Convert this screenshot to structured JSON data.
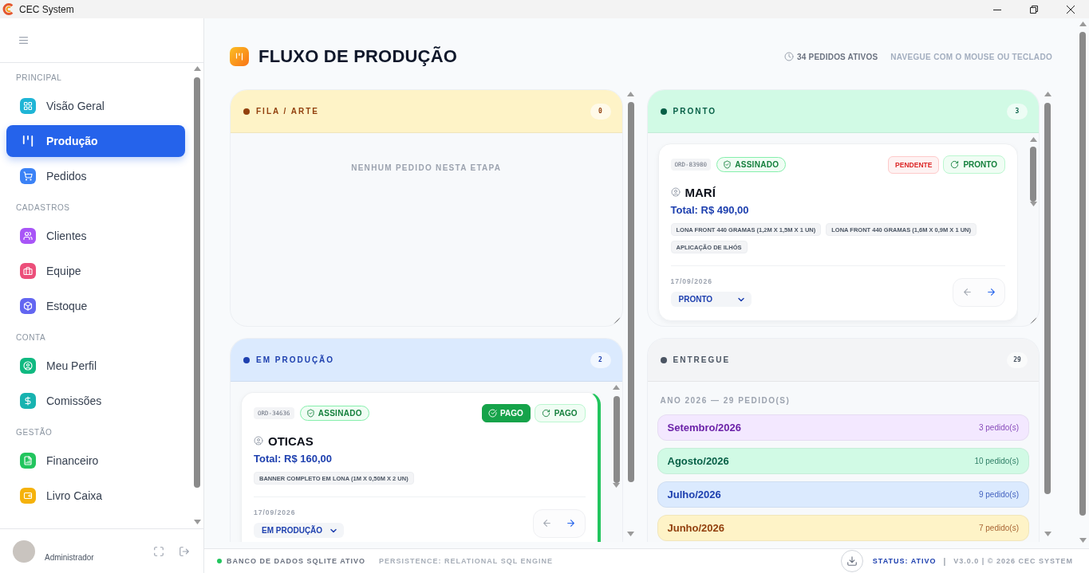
{
  "window": {
    "title": "CEC System"
  },
  "sidebar": {
    "sections": [
      {
        "label": "PRINCIPAL",
        "items": [
          {
            "label": "Visão Geral",
            "selected": false
          },
          {
            "label": "Produção",
            "selected": true
          },
          {
            "label": "Pedidos",
            "selected": false
          }
        ]
      },
      {
        "label": "CADASTROS",
        "items": [
          {
            "label": "Clientes",
            "selected": false
          },
          {
            "label": "Equipe",
            "selected": false
          },
          {
            "label": "Estoque",
            "selected": false
          }
        ]
      },
      {
        "label": "CONTA",
        "items": [
          {
            "label": "Meu Perfil",
            "selected": false
          },
          {
            "label": "Comissões",
            "selected": false
          }
        ]
      },
      {
        "label": "GESTÃO",
        "items": [
          {
            "label": "Financeiro",
            "selected": false
          },
          {
            "label": "Livro Caixa",
            "selected": false
          }
        ]
      }
    ],
    "user": {
      "role": "Administrador"
    }
  },
  "page": {
    "title": "FLUXO DE PRODUÇÃO",
    "active_orders": "34 PEDIDOS ATIVOS",
    "hint": "NAVEGUE COM O MOUSE OU TECLADO"
  },
  "board": {
    "columns": [
      {
        "lanes": [
          {
            "kind": "cards",
            "title": "FILA / ARTE",
            "count": "0",
            "color": "#92400e",
            "header": {
              "color": "#fef3c7"
            },
            "empty_message": "NENHUM PEDIDO NESTA ETAPA"
          },
          {
            "kind": "cards",
            "title": "EM PRODUÇÃO",
            "count": "2",
            "color": "#1e40af",
            "header": {
              "color": "#dbeafe"
            },
            "cards": [
              {
                "order": "ORD-34636",
                "signature": "ASSINADO",
                "payment": {
                  "label": "PAGO",
                  "paid": true
                },
                "action": "PAGO",
                "client": "OTICAS",
                "total": "Total: R$ 160,00",
                "items": [
                  "BANNER COMPLETO EM LONA (1M X 0,50M X 2 UN)"
                ],
                "date": "17/09/2026",
                "stage": "EM PRODUÇÃO"
              }
            ]
          }
        ]
      },
      {
        "lanes": [
          {
            "kind": "cards",
            "title": "PRONTO",
            "count": "3",
            "color": "#065f46",
            "header": {
              "color": "#d1fae5"
            },
            "cards": [
              {
                "order": "ORD-83980",
                "signature": "ASSINADO",
                "payment": {
                  "label": "PENDENTE",
                  "paid": false
                },
                "action": "PRONTO",
                "client": "MARÍ",
                "total": "Total: R$ 490,00",
                "items": [
                  "LONA FRONT 440 GRAMAS (1,2M X 1,5M X 1 UN)",
                  "LONA FRONT 440 GRAMAS (1,6M X 0,9M X 1 UN)",
                  "APLICAÇÃO DE ILHÓS"
                ],
                "date": "17/09/2026",
                "stage": "PRONTO"
              }
            ]
          },
          {
            "kind": "archive",
            "title": "ENTREGUE",
            "count": "29",
            "color": "#4b5563",
            "header": {
              "color": "#f3f4f6"
            },
            "year_heading": "ANO 2026 — 29 PEDIDO(S)",
            "months": [
              {
                "label": "Setembro/2026",
                "count": "3 pedido(s)",
                "color": "#6b21a8",
                "fill": {
                  "color": "#f3e8ff"
                }
              },
              {
                "label": "Agosto/2026",
                "count": "10 pedido(s)",
                "color": "#065f46",
                "fill": {
                  "color": "#d1fae5"
                }
              },
              {
                "label": "Julho/2026",
                "count": "9 pedido(s)",
                "color": "#1e40af",
                "fill": {
                  "color": "#dbeafe"
                }
              },
              {
                "label": "Junho/2026",
                "count": "7 pedido(s)",
                "color": "#92400e",
                "fill": {
                  "color": "#fef3c7"
                }
              }
            ]
          }
        ]
      }
    ]
  },
  "status_bar": {
    "database": "BANCO DE DADOS SQLITE ATIVO",
    "engine": "PERSISTENCE: RELATIONAL SQL ENGINE",
    "status": "STATUS: ATIVO",
    "separator": "|",
    "version": "V3.0.0 | © 2026 CEC SYSTEM"
  }
}
